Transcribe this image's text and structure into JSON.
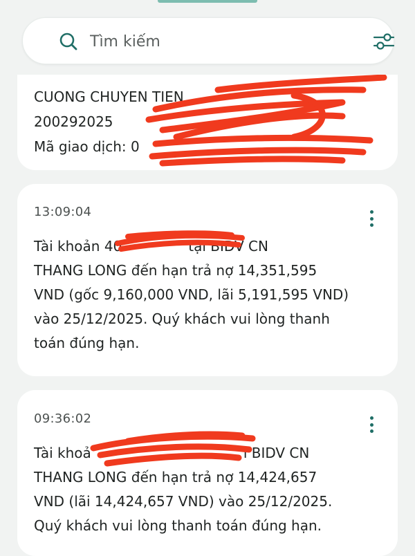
{
  "search": {
    "placeholder": "Tìm kiếm"
  },
  "messages": [
    {
      "lines": [
        "CUONG CHUYEN TIEN",
        "200292025",
        "Mã giao dịch: 0"
      ],
      "redacted": true
    },
    {
      "time": "13:09:04",
      "lines": [
        "Tài khoản 40",
        "tại BIDV CN",
        "THANG LONG đến hạn trả nợ 14,351,595",
        "VND (gốc 9,160,000 VND, lãi 5,191,595 VND)",
        "vào 25/12/2025. Quý khách vui lòng thanh",
        "toán đúng hạn."
      ],
      "redacted": true
    },
    {
      "time": "09:36:02",
      "lines": [
        "Tài khoả",
        "i BIDV CN",
        "THANG LONG đến hạn trả nợ 14,424,657",
        "VND (lãi 14,424,657 VND) vào 25/12/2025.",
        "Quý khách vui lòng thanh toán đúng hạn."
      ],
      "redacted": true
    }
  ],
  "colors": {
    "background": "#f1f3f2",
    "card": "#ffffff",
    "accent": "#1f6e66",
    "redaction": "#f03a1e"
  },
  "icons": {
    "search": "search-icon",
    "filter": "filter-icon",
    "more": "more-vertical-icon"
  }
}
